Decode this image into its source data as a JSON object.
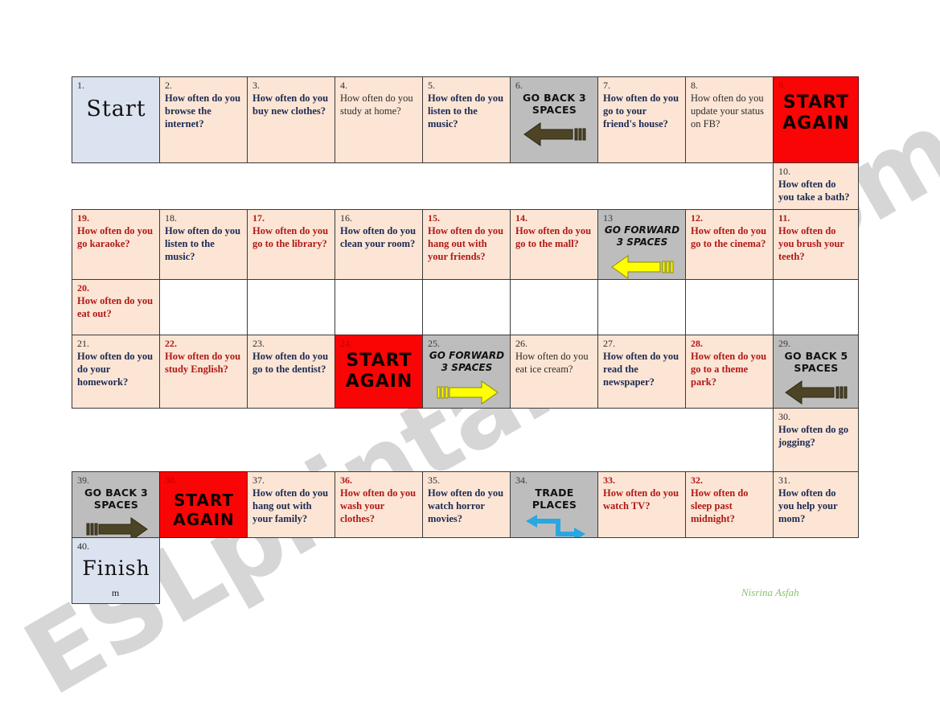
{
  "watermark": {
    "text": "ESLprintables.com"
  },
  "signature": {
    "text": "Nisrina Asfah"
  },
  "rows": [
    {
      "id": "row-1",
      "cells": [
        {
          "num": "1.",
          "kind": "start",
          "title": "Start"
        },
        {
          "num": "2.",
          "kind": "q",
          "style": "blue",
          "text": "How often do you browse the internet?"
        },
        {
          "num": "3.",
          "kind": "q",
          "style": "blue",
          "text": "How often do you buy new clothes?"
        },
        {
          "num": "4.",
          "kind": "q",
          "style": "plain",
          "text": "How often do you study at home?"
        },
        {
          "num": "5.",
          "kind": "q",
          "style": "blue",
          "text": "How often do you listen to the music?"
        },
        {
          "num": "6.",
          "kind": "action",
          "title": "GO BACK 3 SPACES",
          "arrow": "dark-left"
        },
        {
          "num": "7.",
          "kind": "q",
          "style": "blue",
          "text": "How often do you go to your friend's house?"
        },
        {
          "num": "8.",
          "kind": "q",
          "style": "plain",
          "text": "How often do you update your status on FB?"
        },
        {
          "num": "9.",
          "kind": "red",
          "title": "START AGAIN"
        }
      ]
    },
    {
      "id": "row-2-gap",
      "cells": [
        {
          "kind": "spacer"
        },
        {
          "kind": "spacer"
        },
        {
          "kind": "spacer"
        },
        {
          "kind": "spacer"
        },
        {
          "kind": "spacer"
        },
        {
          "kind": "spacer"
        },
        {
          "kind": "spacer"
        },
        {
          "kind": "spacer"
        },
        {
          "num": "10.",
          "kind": "q",
          "style": "blue",
          "text": "How often do you take a bath?"
        }
      ]
    },
    {
      "id": "row-3",
      "cells": [
        {
          "num": "19.",
          "kind": "q",
          "style": "red",
          "text": "How often do you go karaoke?"
        },
        {
          "num": "18.",
          "kind": "q",
          "style": "blue",
          "text": "How often do you listen to the music?"
        },
        {
          "num": "17.",
          "kind": "q",
          "style": "red",
          "text": "How often do you go to the library?"
        },
        {
          "num": "16.",
          "kind": "q",
          "style": "blue",
          "text": " How often do you clean your room?"
        },
        {
          "num": "15.",
          "kind": "q",
          "style": "red",
          "text": "How often do you hang out with your friends?"
        },
        {
          "num": "14.",
          "kind": "q",
          "style": "red",
          "text": " How often do you go to the mall?"
        },
        {
          "num": "13",
          "kind": "action",
          "title": "GO FORWARD 3 SPACES",
          "arrow": "yellow-left",
          "italic": true
        },
        {
          "num": "12.",
          "kind": "q",
          "style": "red",
          "text": "How often do you go to the cinema?"
        },
        {
          "num": "11.",
          "kind": "q",
          "style": "red",
          "text": "How often do you brush your teeth?"
        }
      ]
    },
    {
      "id": "row-4-gap",
      "cells": [
        {
          "num": "20.",
          "kind": "q",
          "style": "red",
          "text": "How often do you eat out?"
        },
        {
          "kind": "blank"
        },
        {
          "kind": "blank"
        },
        {
          "kind": "blank"
        },
        {
          "kind": "blank"
        },
        {
          "kind": "blank"
        },
        {
          "kind": "blank"
        },
        {
          "kind": "blank"
        },
        {
          "kind": "blank"
        }
      ]
    },
    {
      "id": "row-5",
      "cells": [
        {
          "num": "21.",
          "kind": "q",
          "style": "blue",
          "text": "How often do you do your homework?"
        },
        {
          "num": "22.",
          "kind": "q",
          "style": "red",
          "text": "How often do you study English?"
        },
        {
          "num": "23.",
          "kind": "q",
          "style": "blue",
          "text": "How often do you go to the dentist?"
        },
        {
          "num": "24.",
          "kind": "red",
          "title": "START AGAIN"
        },
        {
          "num": "25.",
          "kind": "action",
          "title": "GO FORWARD 3 SPACES",
          "arrow": "yellow-right",
          "italic": true
        },
        {
          "num": "26.",
          "kind": "q",
          "style": "plain",
          "text": "How often do you eat ice cream?"
        },
        {
          "num": "27.",
          "kind": "q",
          "style": "blue",
          "text": "How often do you read the newspaper?"
        },
        {
          "num": "28.",
          "kind": "q",
          "style": "red",
          "text": "How often do you go to a theme park?"
        },
        {
          "num": "29.",
          "kind": "action",
          "title": "GO BACK 5 SPACES",
          "arrow": "dark-left"
        }
      ]
    },
    {
      "id": "row-6-gap",
      "cells": [
        {
          "kind": "spacer"
        },
        {
          "kind": "spacer"
        },
        {
          "kind": "spacer"
        },
        {
          "kind": "spacer"
        },
        {
          "kind": "spacer"
        },
        {
          "kind": "spacer"
        },
        {
          "kind": "spacer"
        },
        {
          "kind": "spacer"
        },
        {
          "num": "30.",
          "kind": "q",
          "style": "blue",
          "text": "How often do go jogging?"
        }
      ]
    },
    {
      "id": "row-7",
      "cells": [
        {
          "num": "39.",
          "kind": "action",
          "title": "GO BACK 3 SPACES",
          "arrow": "dark-right"
        },
        {
          "num": "38.",
          "kind": "red",
          "title": "START AGAIN"
        },
        {
          "num": "37.",
          "kind": "q",
          "style": "blue",
          "text": "How often do you hang out with your family?"
        },
        {
          "num": "36.",
          "kind": "q",
          "style": "red",
          "text": "How often do you wash your clothes?"
        },
        {
          "num": "35.",
          "kind": "q",
          "style": "blue",
          "text": "How often do you watch horror movies?"
        },
        {
          "num": "34.",
          "kind": "action",
          "title": "TRADE PLACES",
          "arrow": "trade"
        },
        {
          "num": "33.",
          "kind": "q",
          "style": "red",
          "text": "How often do you watch TV?"
        },
        {
          "num": "32.",
          "kind": "q",
          "style": "red",
          "text": "How often do sleep past midnight?"
        },
        {
          "num": "31.",
          "kind": "q",
          "style": "blue",
          "text": "How often do you help your mom?"
        }
      ]
    },
    {
      "id": "row-8",
      "cells": [
        {
          "num": "40.",
          "kind": "finish",
          "title": "Finish",
          "sub": "m"
        },
        {
          "kind": "spacer"
        },
        {
          "kind": "spacer"
        },
        {
          "kind": "spacer"
        },
        {
          "kind": "spacer"
        },
        {
          "kind": "spacer"
        },
        {
          "kind": "spacer"
        },
        {
          "kind": "spacer"
        },
        {
          "kind": "spacer"
        }
      ]
    }
  ]
}
